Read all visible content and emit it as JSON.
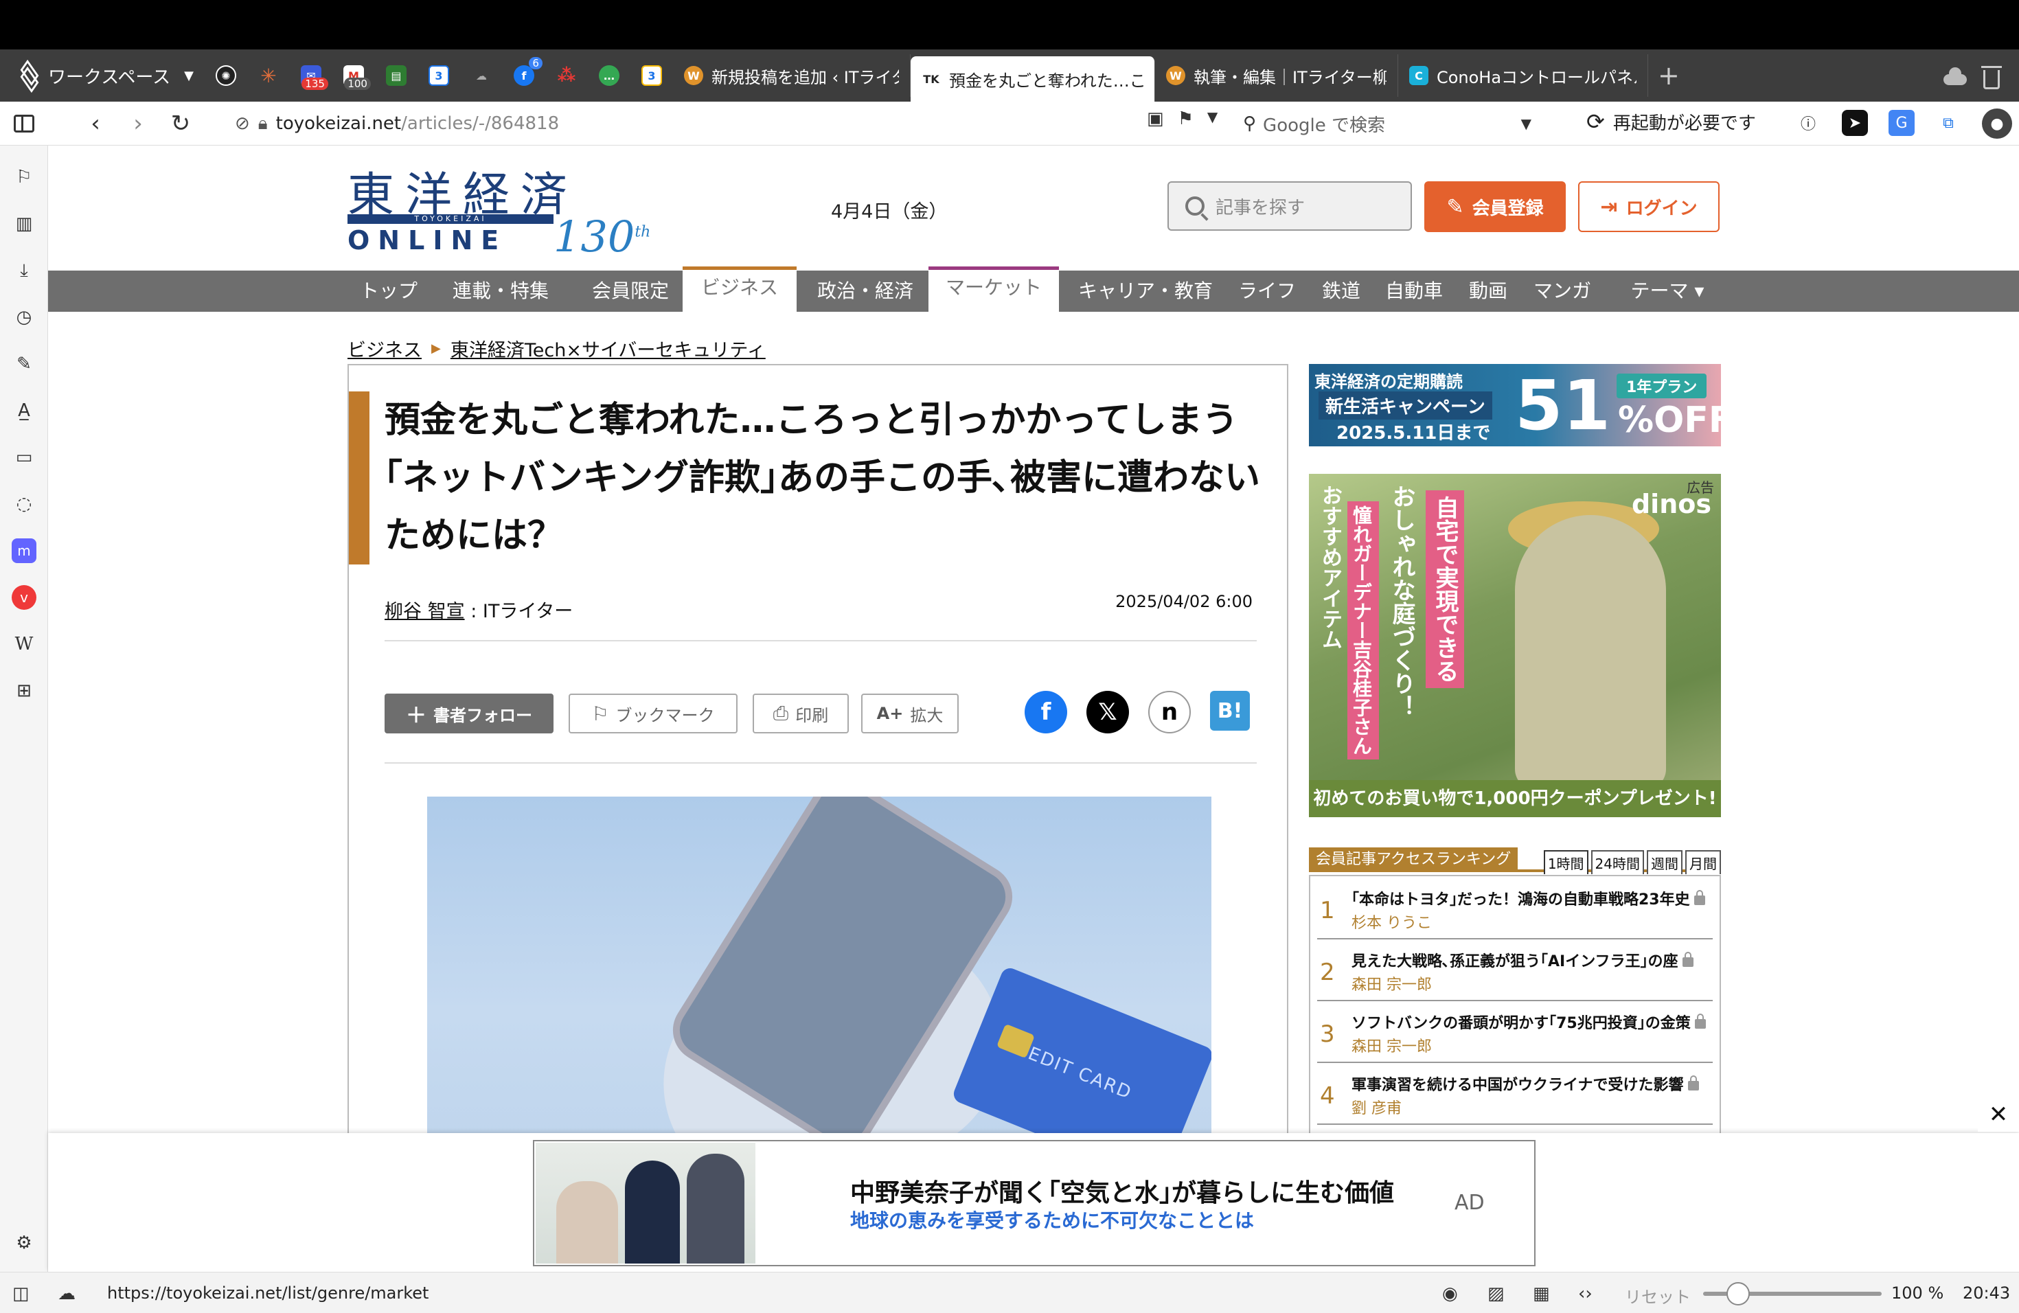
{
  "browser": {
    "workspace_label": "ワークスペース",
    "pinned_badges": [
      "135",
      "100",
      "6",
      "3",
      "3"
    ],
    "tabs": [
      {
        "label": "新規投稿を追加 ‹ ITライター",
        "favicon": "wordpress"
      },
      {
        "label": "預金を丸ごと奪われた…こ",
        "favicon": "toyokeizai",
        "favicon_text": "TK"
      },
      {
        "label": "執筆・編集｜ITライター柳",
        "favicon": "wordpress"
      },
      {
        "label": "ConoHaコントロールパネル",
        "favicon": "conoha",
        "favicon_text": "C"
      }
    ],
    "url_host": "toyokeizai.net",
    "url_path": "/articles/-/864818",
    "search_placeholder": "Google で検索",
    "restart_notice": "再起動が必要です"
  },
  "site": {
    "logo_jp": "東洋経済",
    "logo_sub": "TOYOKEIZAI",
    "logo_online": "ONLINE",
    "logo_years": "130",
    "logo_years_suffix": "th",
    "date": "4月4日（金）",
    "search_placeholder": "記事を探す",
    "register_label": "会員登録",
    "login_label": "ログイン",
    "nav": [
      "トップ",
      "連載・特集",
      "会員限定",
      "ビジネス",
      "政治・経済",
      "マーケット",
      "キャリア・教育",
      "ライフ",
      "鉄道",
      "自動車",
      "動画",
      "マンガ",
      "テーマ ▾"
    ]
  },
  "breadcrumb": [
    "ビジネス",
    "東洋経済Tech×サイバーセキュリティ"
  ],
  "article": {
    "title": "預金を丸ごと奪われた…ころっと引っかかってしまう｢ネットバンキング詐欺｣あの手この手､被害に遭わないためには？",
    "author": "柳谷 智宣",
    "author_role": "ITライター",
    "published": "2025/04/02 6:00",
    "buttons": {
      "follow": "書者フォロー",
      "bookmark": "ブックマーク",
      "print": "印刷",
      "zoom": "拡大"
    },
    "card_text": "CREDIT CARD"
  },
  "promo": {
    "line1": "東洋経済の定期購読",
    "line2": "新生活キャンペーン",
    "line3": "2025.5.11日まで",
    "big": "51",
    "plan": "1年プラン",
    "off": "%OFF"
  },
  "dinos_ad": {
    "ad_label": "広告",
    "brand": "dinos",
    "v1": "自宅で実現できる",
    "v2": "おしゃれな庭づくり！",
    "v3": "憧れガーデナー吉谷桂子さん",
    "v4": "おすすめアイテム",
    "footer": "初めてのお買い物で1,000円クーポンプレゼント!"
  },
  "ranking": {
    "title": "会員記事アクセスランキング",
    "tabs": [
      "1時間",
      "24時間",
      "週間",
      "月間"
    ],
    "items": [
      {
        "rank": "1",
        "title": "｢本命はトヨタ｣だった！鴻海の自動車戦略23年史",
        "author": "杉本 りうこ"
      },
      {
        "rank": "2",
        "title": "見えた大戦略､孫正義が狙う｢AIインフラ王｣の座",
        "author": "森田 宗一郎"
      },
      {
        "rank": "3",
        "title": "ソフトバンクの番頭が明かす｢75兆円投資｣の金策",
        "author": "森田 宗一郎"
      },
      {
        "rank": "4",
        "title": "軍事演習を続ける中国がウクライナで受けた影響",
        "author": "劉 彦甫"
      }
    ]
  },
  "bottom_ad": {
    "title": "中野美奈子が聞く｢空気と水｣が暮らしに生む価値",
    "subtitle": "地球の恵みを享受するために不可欠なこととは",
    "label": "AD"
  },
  "statusbar": {
    "link_url": "https://toyokeizai.net/list/genre/market",
    "reset": "リセット",
    "zoom": "100 %",
    "clock": "20:43"
  }
}
